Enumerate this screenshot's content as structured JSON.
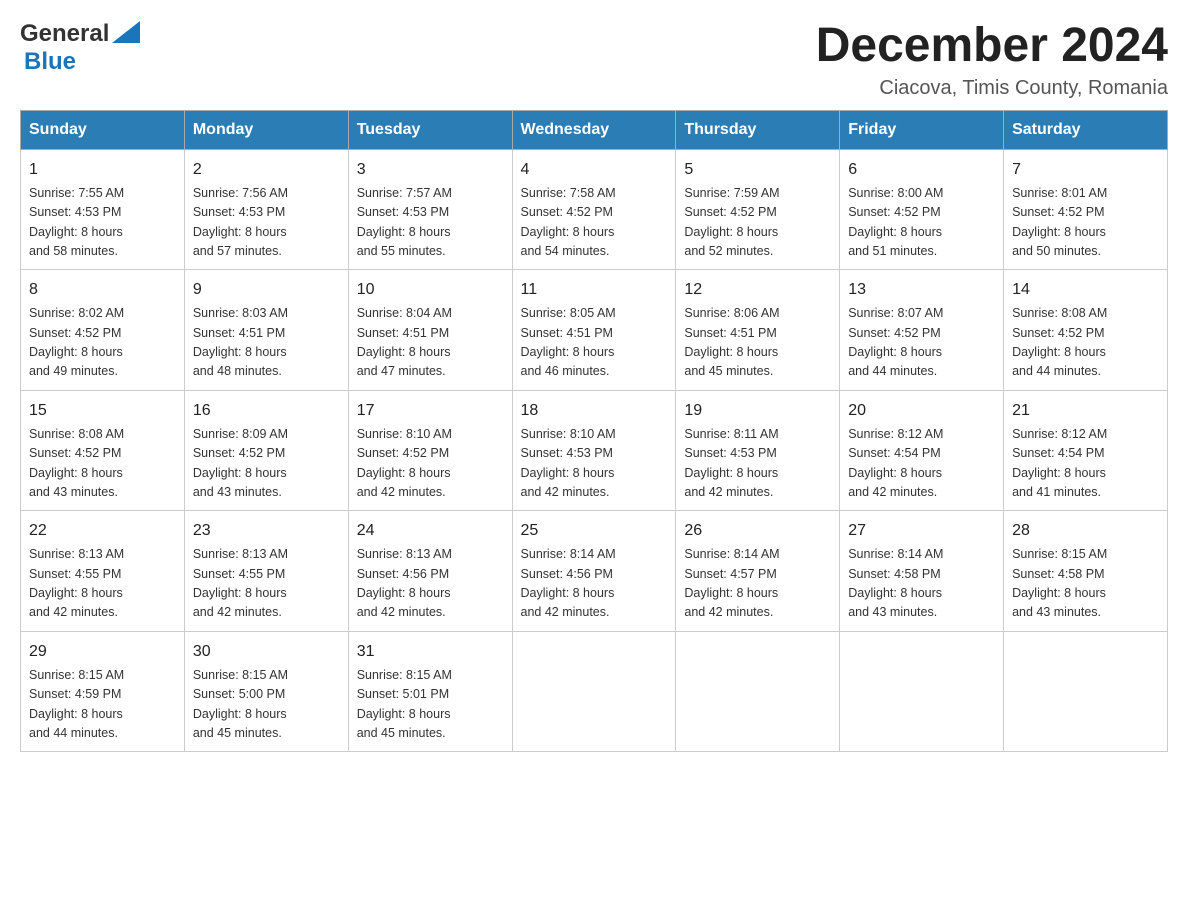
{
  "header": {
    "logo": {
      "general": "General",
      "blue": "Blue"
    },
    "title": "December 2024",
    "location": "Ciacova, Timis County, Romania"
  },
  "weekdays": [
    "Sunday",
    "Monday",
    "Tuesday",
    "Wednesday",
    "Thursday",
    "Friday",
    "Saturday"
  ],
  "weeks": [
    [
      {
        "day": "1",
        "sunrise": "7:55 AM",
        "sunset": "4:53 PM",
        "daylight": "8 hours and 58 minutes."
      },
      {
        "day": "2",
        "sunrise": "7:56 AM",
        "sunset": "4:53 PM",
        "daylight": "8 hours and 57 minutes."
      },
      {
        "day": "3",
        "sunrise": "7:57 AM",
        "sunset": "4:53 PM",
        "daylight": "8 hours and 55 minutes."
      },
      {
        "day": "4",
        "sunrise": "7:58 AM",
        "sunset": "4:52 PM",
        "daylight": "8 hours and 54 minutes."
      },
      {
        "day": "5",
        "sunrise": "7:59 AM",
        "sunset": "4:52 PM",
        "daylight": "8 hours and 52 minutes."
      },
      {
        "day": "6",
        "sunrise": "8:00 AM",
        "sunset": "4:52 PM",
        "daylight": "8 hours and 51 minutes."
      },
      {
        "day": "7",
        "sunrise": "8:01 AM",
        "sunset": "4:52 PM",
        "daylight": "8 hours and 50 minutes."
      }
    ],
    [
      {
        "day": "8",
        "sunrise": "8:02 AM",
        "sunset": "4:52 PM",
        "daylight": "8 hours and 49 minutes."
      },
      {
        "day": "9",
        "sunrise": "8:03 AM",
        "sunset": "4:51 PM",
        "daylight": "8 hours and 48 minutes."
      },
      {
        "day": "10",
        "sunrise": "8:04 AM",
        "sunset": "4:51 PM",
        "daylight": "8 hours and 47 minutes."
      },
      {
        "day": "11",
        "sunrise": "8:05 AM",
        "sunset": "4:51 PM",
        "daylight": "8 hours and 46 minutes."
      },
      {
        "day": "12",
        "sunrise": "8:06 AM",
        "sunset": "4:51 PM",
        "daylight": "8 hours and 45 minutes."
      },
      {
        "day": "13",
        "sunrise": "8:07 AM",
        "sunset": "4:52 PM",
        "daylight": "8 hours and 44 minutes."
      },
      {
        "day": "14",
        "sunrise": "8:08 AM",
        "sunset": "4:52 PM",
        "daylight": "8 hours and 44 minutes."
      }
    ],
    [
      {
        "day": "15",
        "sunrise": "8:08 AM",
        "sunset": "4:52 PM",
        "daylight": "8 hours and 43 minutes."
      },
      {
        "day": "16",
        "sunrise": "8:09 AM",
        "sunset": "4:52 PM",
        "daylight": "8 hours and 43 minutes."
      },
      {
        "day": "17",
        "sunrise": "8:10 AM",
        "sunset": "4:52 PM",
        "daylight": "8 hours and 42 minutes."
      },
      {
        "day": "18",
        "sunrise": "8:10 AM",
        "sunset": "4:53 PM",
        "daylight": "8 hours and 42 minutes."
      },
      {
        "day": "19",
        "sunrise": "8:11 AM",
        "sunset": "4:53 PM",
        "daylight": "8 hours and 42 minutes."
      },
      {
        "day": "20",
        "sunrise": "8:12 AM",
        "sunset": "4:54 PM",
        "daylight": "8 hours and 42 minutes."
      },
      {
        "day": "21",
        "sunrise": "8:12 AM",
        "sunset": "4:54 PM",
        "daylight": "8 hours and 41 minutes."
      }
    ],
    [
      {
        "day": "22",
        "sunrise": "8:13 AM",
        "sunset": "4:55 PM",
        "daylight": "8 hours and 42 minutes."
      },
      {
        "day": "23",
        "sunrise": "8:13 AM",
        "sunset": "4:55 PM",
        "daylight": "8 hours and 42 minutes."
      },
      {
        "day": "24",
        "sunrise": "8:13 AM",
        "sunset": "4:56 PM",
        "daylight": "8 hours and 42 minutes."
      },
      {
        "day": "25",
        "sunrise": "8:14 AM",
        "sunset": "4:56 PM",
        "daylight": "8 hours and 42 minutes."
      },
      {
        "day": "26",
        "sunrise": "8:14 AM",
        "sunset": "4:57 PM",
        "daylight": "8 hours and 42 minutes."
      },
      {
        "day": "27",
        "sunrise": "8:14 AM",
        "sunset": "4:58 PM",
        "daylight": "8 hours and 43 minutes."
      },
      {
        "day": "28",
        "sunrise": "8:15 AM",
        "sunset": "4:58 PM",
        "daylight": "8 hours and 43 minutes."
      }
    ],
    [
      {
        "day": "29",
        "sunrise": "8:15 AM",
        "sunset": "4:59 PM",
        "daylight": "8 hours and 44 minutes."
      },
      {
        "day": "30",
        "sunrise": "8:15 AM",
        "sunset": "5:00 PM",
        "daylight": "8 hours and 45 minutes."
      },
      {
        "day": "31",
        "sunrise": "8:15 AM",
        "sunset": "5:01 PM",
        "daylight": "8 hours and 45 minutes."
      },
      null,
      null,
      null,
      null
    ]
  ],
  "labels": {
    "sunrise": "Sunrise:",
    "sunset": "Sunset:",
    "daylight": "Daylight:"
  }
}
